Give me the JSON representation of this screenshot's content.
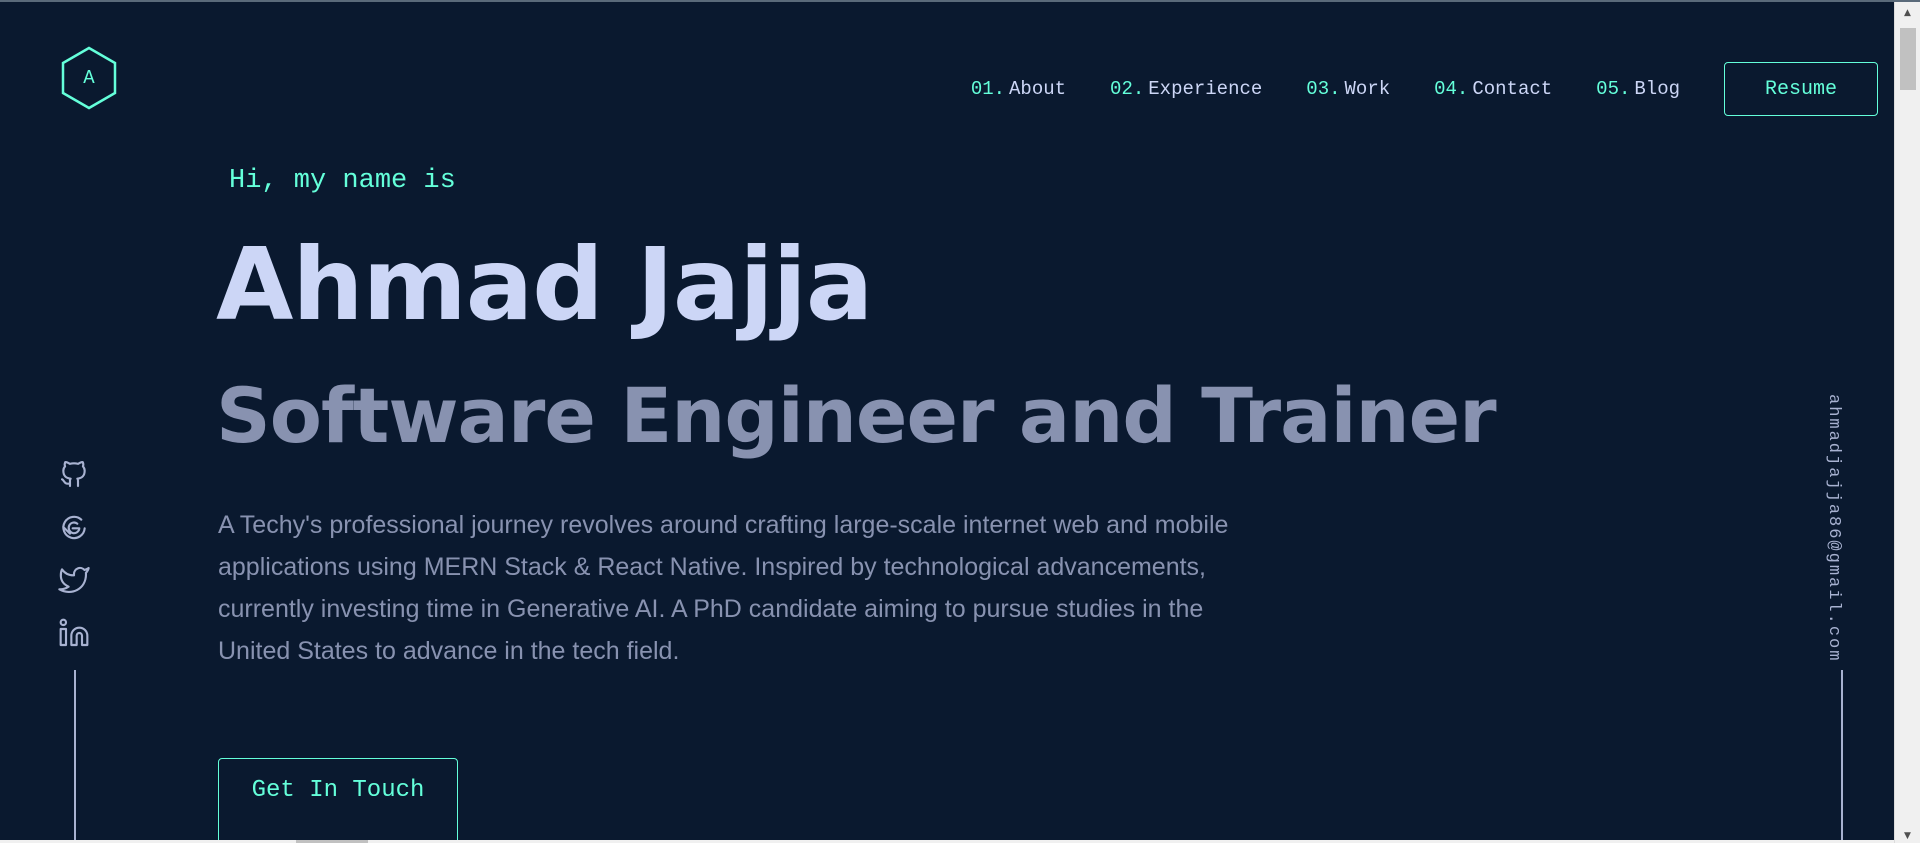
{
  "logo": {
    "letter": "A"
  },
  "nav": {
    "items": [
      {
        "num": "01.",
        "label": "About"
      },
      {
        "num": "02.",
        "label": "Experience"
      },
      {
        "num": "03.",
        "label": "Work"
      },
      {
        "num": "04.",
        "label": "Contact"
      },
      {
        "num": "05.",
        "label": "Blog"
      }
    ],
    "resume_label": "Resume"
  },
  "hero": {
    "greeting": "Hi, my name is",
    "name": "Ahmad Jajja",
    "tagline": "Software Engineer and Trainer",
    "bio": "A Techy's professional journey revolves around crafting large-scale internet web and mobile applications using MERN Stack & React Native. Inspired by technological advancements, currently investing time in Generative AI. A PhD candidate aiming to pursue studies in the United States to advance in the tech field.",
    "cta_label": "Get In Touch"
  },
  "social": {
    "icons": [
      "github-icon",
      "codepen-icon",
      "twitter-icon",
      "linkedin-icon"
    ]
  },
  "email": "ahmadjajja86@gmail.com",
  "colors": {
    "background": "#0a192f",
    "accent": "#64ffda",
    "heading": "#ccd6f6",
    "muted": "#8892b0",
    "light": "#a8b2d1"
  },
  "scrollbar": {
    "up_arrow": "▲",
    "down_arrow": "▼"
  }
}
